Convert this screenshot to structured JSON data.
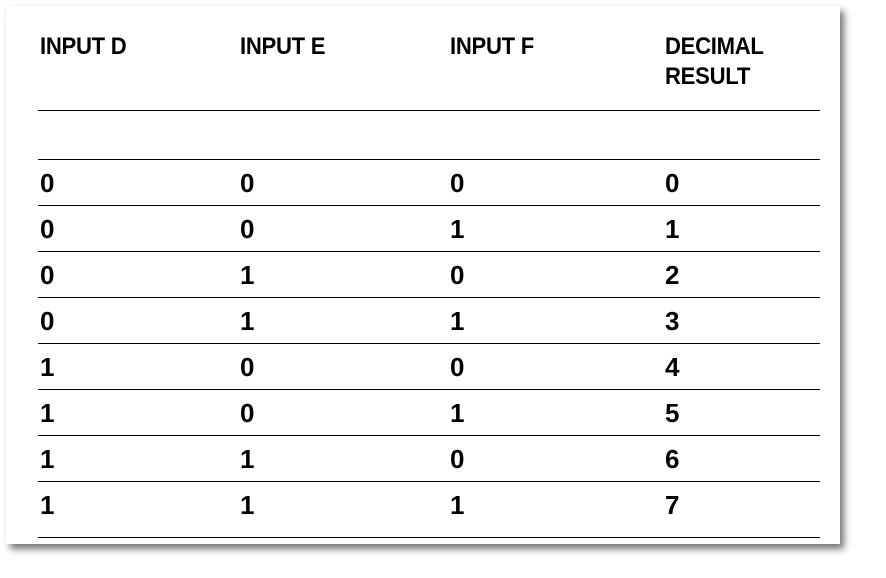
{
  "table": {
    "headers": [
      "INPUT D",
      "INPUT E",
      "INPUT F",
      "DECIMAL",
      "RESULT"
    ],
    "rows": [
      [
        "0",
        "0",
        "0",
        "0"
      ],
      [
        "0",
        "0",
        "1",
        "1"
      ],
      [
        "0",
        "1",
        "0",
        "2"
      ],
      [
        "0",
        "1",
        "1",
        "3"
      ],
      [
        "1",
        "0",
        "0",
        "4"
      ],
      [
        "1",
        "0",
        "1",
        "5"
      ],
      [
        "1",
        "1",
        "0",
        "6"
      ],
      [
        "1",
        "1",
        "1",
        "7"
      ]
    ]
  }
}
